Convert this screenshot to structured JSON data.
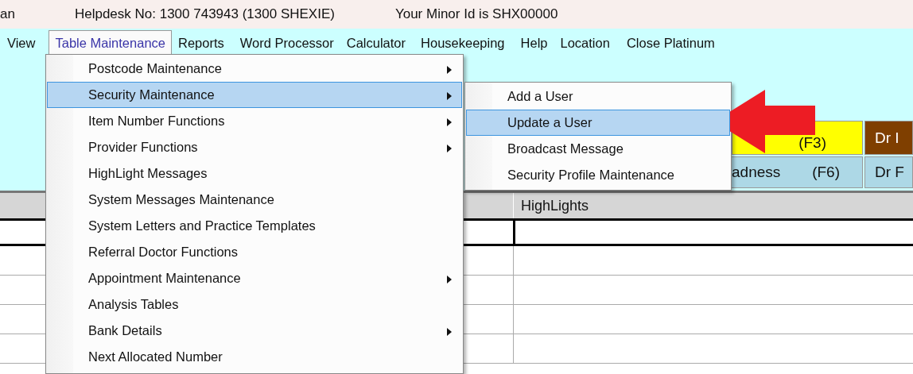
{
  "top_bar": {
    "texts": [
      "an",
      "Helpdesk No: 1300 743943 (1300 SHEXIE)",
      "Your Minor Id is SHX00000"
    ]
  },
  "menu_bar": [
    {
      "label": "View",
      "selected": false
    },
    {
      "label": "Table Maintenance",
      "selected": true
    },
    {
      "label": "Reports",
      "selected": false
    },
    {
      "label": "Word Processor",
      "selected": false
    },
    {
      "label": "Calculator",
      "selected": false
    },
    {
      "label": "Housekeeping",
      "selected": false
    },
    {
      "label": "Help",
      "selected": false
    },
    {
      "label": "Location",
      "selected": false
    },
    {
      "label": "Close Platinum",
      "selected": false
    }
  ],
  "menu": [
    {
      "label": "Postcode Maintenance",
      "has_submenu": true,
      "selected": false
    },
    {
      "label": "Security Maintenance",
      "has_submenu": true,
      "selected": true
    },
    {
      "label": "Item Number Functions",
      "has_submenu": true,
      "selected": false
    },
    {
      "label": "Provider Functions",
      "has_submenu": true,
      "selected": false
    },
    {
      "label": "HighLight Messages",
      "has_submenu": false,
      "selected": false
    },
    {
      "label": "System Messages Maintenance",
      "has_submenu": false,
      "selected": false
    },
    {
      "label": "System Letters and Practice Templates",
      "has_submenu": false,
      "selected": false
    },
    {
      "label": "Referral Doctor Functions",
      "has_submenu": false,
      "selected": false
    },
    {
      "label": "Appointment Maintenance",
      "has_submenu": true,
      "selected": false
    },
    {
      "label": "Analysis Tables",
      "has_submenu": false,
      "selected": false
    },
    {
      "label": "Bank Details",
      "has_submenu": true,
      "selected": false
    },
    {
      "label": "Next Allocated Number",
      "has_submenu": false,
      "selected": false
    }
  ],
  "submenu": [
    {
      "label": "Add a User",
      "selected": false
    },
    {
      "label": "Update a User",
      "selected": true
    },
    {
      "label": "Broadcast Message",
      "selected": false
    },
    {
      "label": "Security Profile Maintenance",
      "selected": false
    }
  ],
  "function_buttons": [
    [
      {
        "texts": [
          "(F3)"
        ],
        "color": "#ffff00"
      },
      {
        "texts": [
          "Dr I"
        ],
        "color": "#7f3f00"
      }
    ],
    [
      {
        "texts": [
          "adness",
          "(F6)"
        ],
        "color": "#add8e6"
      },
      {
        "texts": [
          "Dr F"
        ],
        "color": "#add8e6"
      }
    ]
  ],
  "grid": {
    "columns": [
      "HighLights"
    ]
  }
}
